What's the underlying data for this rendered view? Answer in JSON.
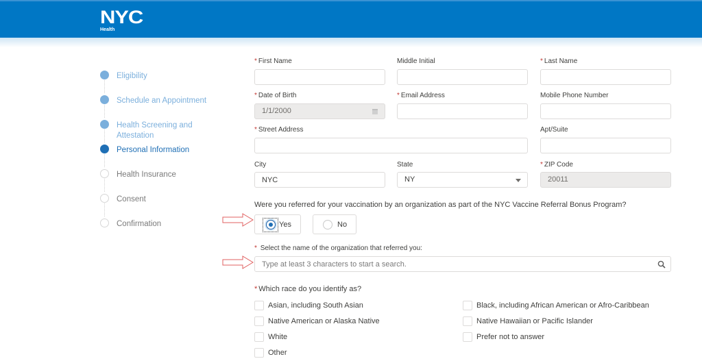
{
  "header": {
    "logo_main": "NYC",
    "logo_sub": "Health",
    "brand_color": "#0077c5"
  },
  "steps": [
    {
      "label": "Eligibility",
      "status": "done"
    },
    {
      "label": "Schedule an Appointment",
      "status": "done"
    },
    {
      "label": "Health Screening and Attestation",
      "status": "done"
    },
    {
      "label": "Personal Information",
      "status": "active"
    },
    {
      "label": "Health Insurance",
      "status": "todo"
    },
    {
      "label": "Consent",
      "status": "todo"
    },
    {
      "label": "Confirmation",
      "status": "todo"
    }
  ],
  "form": {
    "required_marker": "*",
    "first_name": {
      "label": "First Name",
      "value": ""
    },
    "middle_initial": {
      "label": "Middle Initial",
      "value": ""
    },
    "last_name": {
      "label": "Last Name",
      "value": ""
    },
    "date_of_birth": {
      "label": "Date of Birth",
      "value": "1/1/2000"
    },
    "email": {
      "label": "Email Address",
      "value": ""
    },
    "mobile_phone": {
      "label": "Mobile Phone Number",
      "value": ""
    },
    "street_address": {
      "label": "Street Address",
      "value": ""
    },
    "apt_suite": {
      "label": "Apt/Suite",
      "value": ""
    },
    "city": {
      "label": "City",
      "value": "NYC"
    },
    "state": {
      "label": "State",
      "value": "NY"
    },
    "zip": {
      "label": "ZIP Code",
      "value": "20011"
    },
    "referral_question": "Were you referred for your vaccination by an organization as part of the NYC Vaccine Referral Bonus Program?",
    "referral_options": {
      "yes": "Yes",
      "no": "No",
      "selected": "Yes"
    },
    "org_search": {
      "label": "Select the name of the organization that referred you:",
      "placeholder": "Type at least 3 characters to start a search."
    },
    "race": {
      "label": "Which race do you identify as?",
      "options": [
        {
          "label": "Asian, including South Asian",
          "checked": false
        },
        {
          "label": "Black, including African American or Afro-Caribbean",
          "checked": false
        },
        {
          "label": "Native American or Alaska Native",
          "checked": false
        },
        {
          "label": "Native Hawaiian or Pacific Islander",
          "checked": false
        },
        {
          "label": "White",
          "checked": false
        },
        {
          "label": "Prefer not to answer",
          "checked": false
        },
        {
          "label": "Other",
          "checked": false
        }
      ]
    }
  }
}
